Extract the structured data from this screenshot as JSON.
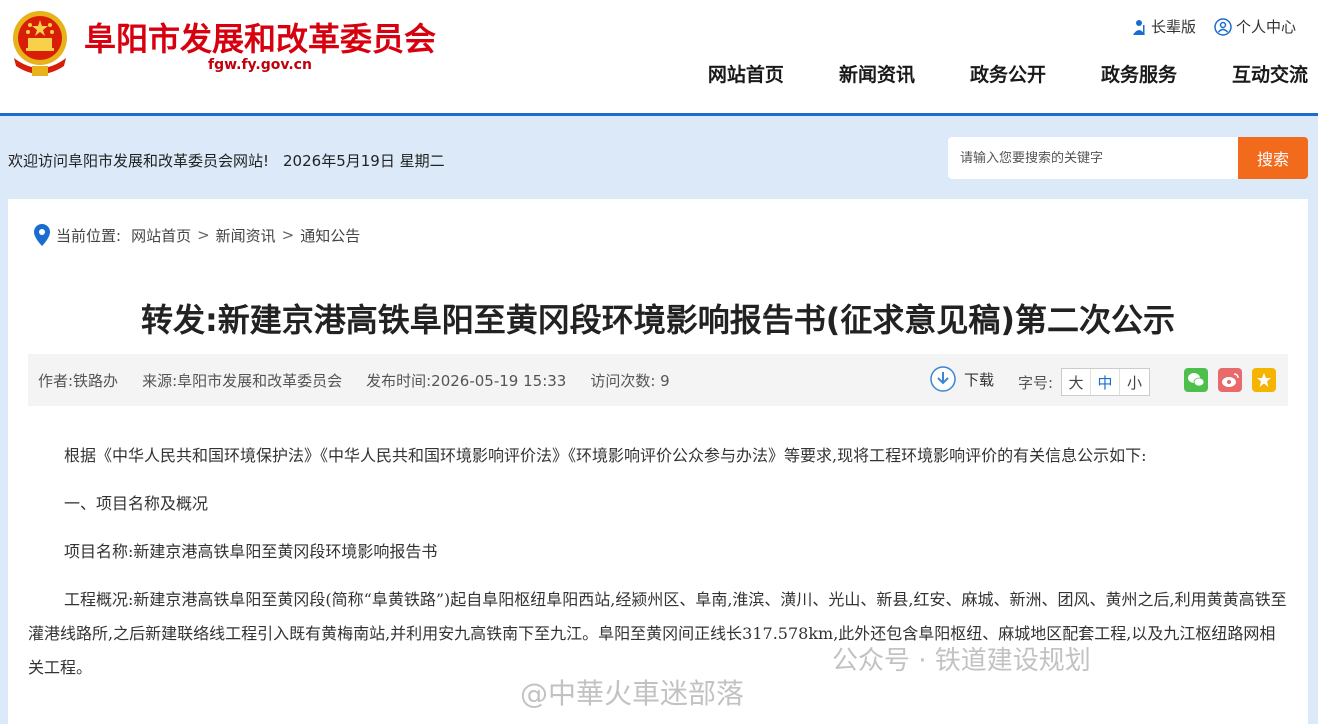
{
  "header": {
    "site_title": "阜阳市发展和改革委员会",
    "site_domain": "fgw.fy.gov.cn",
    "top_links": [
      {
        "label": "长辈版",
        "icon": "elder-icon"
      },
      {
        "label": "个人中心",
        "icon": "user-icon"
      }
    ],
    "nav": [
      "网站首页",
      "新闻资讯",
      "政务公开",
      "政务服务",
      "互动交流"
    ]
  },
  "search_band": {
    "welcome": "欢迎访问阜阳市发展和改革委员会网站!",
    "date": "2026年5月19日 星期二",
    "search_placeholder": "请输入您要搜索的关键字",
    "search_button": "搜索"
  },
  "breadcrumb": {
    "label": "当前位置:",
    "items": [
      "网站首页",
      "新闻资讯",
      "通知公告"
    ],
    "separator": ">"
  },
  "article": {
    "title": "转发:新建京港高铁阜阳至黄冈段环境影响报告书(征求意见稿)第二次公示",
    "meta": {
      "author": "作者:铁路办",
      "source": "来源:阜阳市发展和改革委员会",
      "published": "发布时间:2026-05-19 15:33",
      "visits": "访问次数: 9"
    },
    "download_label": "下载",
    "font_size_label": "字号:",
    "font_sizes": [
      "大",
      "中",
      "小"
    ],
    "share_icons": [
      "wechat-icon",
      "weibo-icon",
      "favorite-icon"
    ],
    "paragraphs": [
      "根据《中华人民共和国环境保护法》《中华人民共和国环境影响评价法》《环境影响评价公众参与办法》等要求,现将工程环境影响评价的有关信息公示如下:",
      "一、项目名称及概况",
      "项目名称:新建京港高铁阜阳至黄冈段环境影响报告书",
      "工程概况:新建京港高铁阜阳至黄冈段(简称“阜黄铁路”)起自阜阳枢纽阜阳西站,经颍州区、阜南,淮滨、潢川、光山、新县,红安、麻城、新洲、团风、黄州之后,利用黄黄高铁至灌港线路所,之后新建联络线工程引入既有黄梅南站,并利用安九高铁南下至九江。阜阳至黄冈间正线长317.578km,此外还包含阜阳枢纽、麻城地区配套工程,以及九江枢纽路网相关工程。"
    ]
  },
  "watermark": {
    "line1": "公众号 · 铁道建设规划",
    "line2": "@中華火車迷部落"
  },
  "colors": {
    "brand_red": "#d7000f",
    "accent_blue": "#1a6dcf",
    "search_orange": "#f26a1b",
    "band_blue": "#dce9f8"
  }
}
